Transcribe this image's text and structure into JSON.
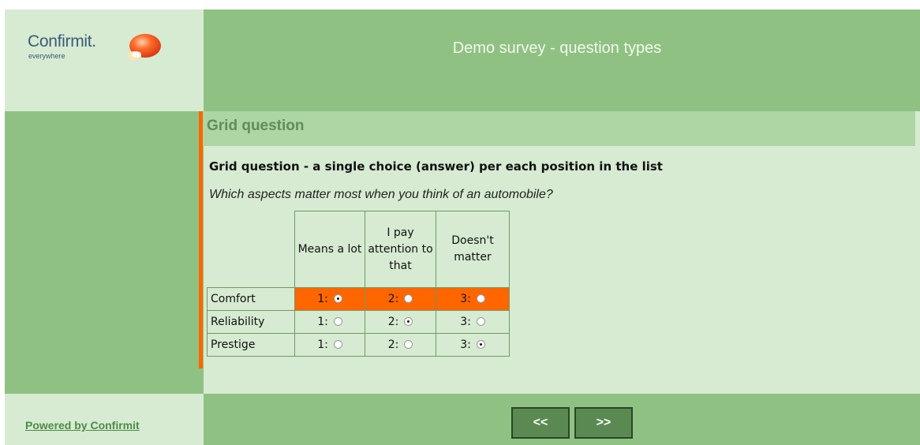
{
  "logo": {
    "brand": "Confirmit.",
    "tagline": "everywhere"
  },
  "header": {
    "survey_title": "Demo survey - question types"
  },
  "question": {
    "section_title": "Grid question",
    "text": "Grid question - a single choice (answer) per each position in the list",
    "subtext": "Which aspects matter most when you think of an automobile?",
    "columns": [
      "Means a lot",
      "I pay attention to that",
      "Doesn't matter"
    ],
    "rows": [
      {
        "label": "Comfort",
        "selected": 1,
        "highlighted": true
      },
      {
        "label": "Reliability",
        "selected": 2,
        "highlighted": false
      },
      {
        "label": "Prestige",
        "selected": 3,
        "highlighted": false
      }
    ],
    "option_labels": [
      "1:",
      "2:",
      "3:"
    ]
  },
  "footer": {
    "powered_by": "Powered by Confirmit",
    "prev_label": "<<",
    "next_label": ">>"
  },
  "colors": {
    "accent": "#ff6600",
    "panel_green": "#8fc282",
    "light_green": "#d6ebd2",
    "header_green": "#aed5a4"
  }
}
